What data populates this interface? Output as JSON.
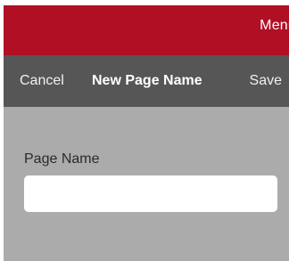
{
  "app_bar": {
    "menu_label": "Menu"
  },
  "nav": {
    "cancel_label": "Cancel",
    "title": "New Page Name",
    "save_label": "Save"
  },
  "form": {
    "page_name_label": "Page Name",
    "page_name_value": "",
    "page_name_placeholder": ""
  },
  "colors": {
    "brand_red": "#b00f24",
    "nav_bar": "#565656",
    "sheet_background": "#ababab"
  }
}
